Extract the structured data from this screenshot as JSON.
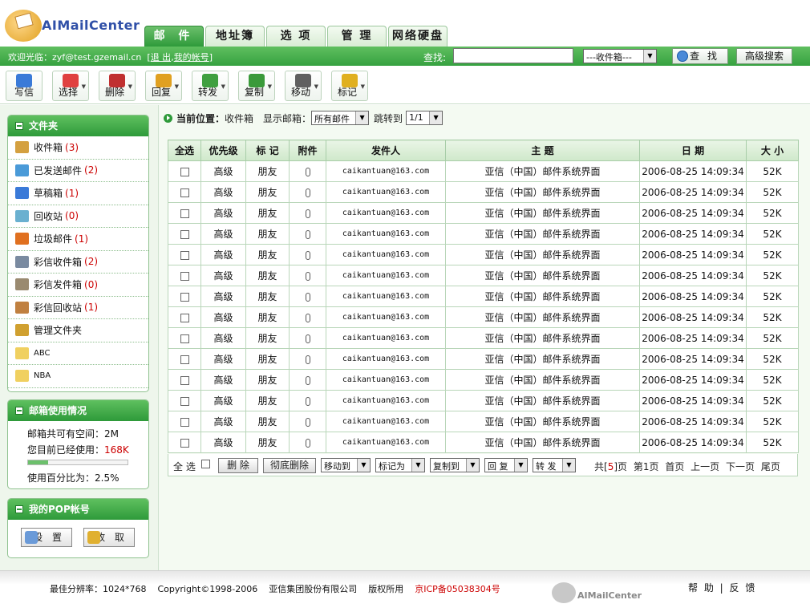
{
  "brand": {
    "logo_text": "AIMailCenter"
  },
  "tabs": [
    "邮 件",
    "地址簿",
    "选 项",
    "管 理",
    "网络硬盘"
  ],
  "topbar": {
    "welcome_prefix": "欢迎光临：zyf@test.gzemail.cn",
    "logout": "退 出",
    "my_account": "我的帐号",
    "search_label": "查找:",
    "search_value": "",
    "folder_select": "---收件箱---",
    "find_button": "查 找",
    "advanced_search": "高级搜索"
  },
  "toolbar": [
    {
      "label": "写信",
      "icon": "compose-icon",
      "color": "#3a7ad8",
      "dropdown": false
    },
    {
      "label": "选择",
      "icon": "checkmark-icon",
      "color": "#e04040",
      "dropdown": true
    },
    {
      "label": "删除",
      "icon": "delete-icon",
      "color": "#c03030",
      "dropdown": true
    },
    {
      "label": "回复",
      "icon": "reply-icon",
      "color": "#e0a020",
      "dropdown": true
    },
    {
      "label": "转发",
      "icon": "forward-icon",
      "color": "#40a040",
      "dropdown": true
    },
    {
      "label": "复制",
      "icon": "copy-icon",
      "color": "#3a9a3a",
      "dropdown": true
    },
    {
      "label": "移动",
      "icon": "move-icon",
      "color": "#606060",
      "dropdown": true
    },
    {
      "label": "标记",
      "icon": "flag-icon",
      "color": "#e0b020",
      "dropdown": true
    }
  ],
  "sidebar": {
    "folders_title": "文件夹",
    "folders": [
      {
        "name": "收件箱",
        "count": "(3)",
        "icon": "inbox-icon",
        "color": "#d4a040"
      },
      {
        "name": "已发送邮件",
        "count": "(2)",
        "icon": "sent-icon",
        "color": "#4a9ad8"
      },
      {
        "name": "草稿箱",
        "count": "(1)",
        "icon": "drafts-icon",
        "color": "#3a7ad8"
      },
      {
        "name": "回收站",
        "count": "(0)",
        "icon": "recycle-icon",
        "color": "#6ab0d0"
      },
      {
        "name": "垃圾邮件",
        "count": "(1)",
        "icon": "spam-icon",
        "color": "#e07020"
      },
      {
        "name": "彩信收件箱",
        "count": "(2)",
        "icon": "mms-inbox-icon",
        "color": "#7a8aa0"
      },
      {
        "name": "彩信发件箱",
        "count": "(0)",
        "icon": "mms-outbox-icon",
        "color": "#9a8a70"
      },
      {
        "name": "彩信回收站",
        "count": "(1)",
        "icon": "mms-recycle-icon",
        "color": "#c08040"
      },
      {
        "name": "管理文件夹",
        "count": "",
        "icon": "manage-folders-icon",
        "color": "#d0a030"
      },
      {
        "name": "ABC",
        "count": "",
        "icon": "folder-icon",
        "color": "#f0d060",
        "small": true
      },
      {
        "name": "NBA",
        "count": "",
        "icon": "folder-icon",
        "color": "#f0d060",
        "small": true
      }
    ],
    "usage_title": "邮箱使用情况",
    "usage_total": "邮箱共可有空间：2M",
    "usage_used_label": "您目前已经使用：",
    "usage_used_value": "168K",
    "usage_percent": "使用百分比为：2.5%",
    "usage_fraction": 0.2,
    "pop_title": "我的POP帐号",
    "pop_settings": "设 置",
    "pop_receive": "收 取"
  },
  "location": {
    "label": "当前位置：",
    "value": "收件箱",
    "show_label": "显示邮箱：",
    "show_value": "所有邮件",
    "jump_label": "跳转到",
    "page_value": "1/1"
  },
  "table": {
    "columns": [
      "全选",
      "优先级",
      "标 记",
      "附件",
      "发件人",
      "主 题",
      "日 期",
      "大 小"
    ],
    "rows": [
      {
        "priority": "高级",
        "tag": "朋友",
        "from": "caikantuan@163.com",
        "subject": "亚信（中国）邮件系统界面",
        "date": "2006-08-25 14:09:34",
        "size": "52K"
      },
      {
        "priority": "高级",
        "tag": "朋友",
        "from": "caikantuan@163.com",
        "subject": "亚信（中国）邮件系统界面",
        "date": "2006-08-25 14:09:34",
        "size": "52K"
      },
      {
        "priority": "高级",
        "tag": "朋友",
        "from": "caikantuan@163.com",
        "subject": "亚信（中国）邮件系统界面",
        "date": "2006-08-25 14:09:34",
        "size": "52K"
      },
      {
        "priority": "高级",
        "tag": "朋友",
        "from": "caikantuan@163.com",
        "subject": "亚信（中国）邮件系统界面",
        "date": "2006-08-25 14:09:34",
        "size": "52K"
      },
      {
        "priority": "高级",
        "tag": "朋友",
        "from": "caikantuan@163.com",
        "subject": "亚信（中国）邮件系统界面",
        "date": "2006-08-25 14:09:34",
        "size": "52K"
      },
      {
        "priority": "高级",
        "tag": "朋友",
        "from": "caikantuan@163.com",
        "subject": "亚信（中国）邮件系统界面",
        "date": "2006-08-25 14:09:34",
        "size": "52K"
      },
      {
        "priority": "高级",
        "tag": "朋友",
        "from": "caikantuan@163.com",
        "subject": "亚信（中国）邮件系统界面",
        "date": "2006-08-25 14:09:34",
        "size": "52K"
      },
      {
        "priority": "高级",
        "tag": "朋友",
        "from": "caikantuan@163.com",
        "subject": "亚信（中国）邮件系统界面",
        "date": "2006-08-25 14:09:34",
        "size": "52K"
      },
      {
        "priority": "高级",
        "tag": "朋友",
        "from": "caikantuan@163.com",
        "subject": "亚信（中国）邮件系统界面",
        "date": "2006-08-25 14:09:34",
        "size": "52K"
      },
      {
        "priority": "高级",
        "tag": "朋友",
        "from": "caikantuan@163.com",
        "subject": "亚信（中国）邮件系统界面",
        "date": "2006-08-25 14:09:34",
        "size": "52K"
      },
      {
        "priority": "高级",
        "tag": "朋友",
        "from": "caikantuan@163.com",
        "subject": "亚信（中国）邮件系统界面",
        "date": "2006-08-25 14:09:34",
        "size": "52K"
      },
      {
        "priority": "高级",
        "tag": "朋友",
        "from": "caikantuan@163.com",
        "subject": "亚信（中国）邮件系统界面",
        "date": "2006-08-25 14:09:34",
        "size": "52K"
      },
      {
        "priority": "高级",
        "tag": "朋友",
        "from": "caikantuan@163.com",
        "subject": "亚信（中国）邮件系统界面",
        "date": "2006-08-25 14:09:34",
        "size": "52K"
      },
      {
        "priority": "高级",
        "tag": "朋友",
        "from": "caikantuan@163.com",
        "subject": "亚信（中国）邮件系统界面",
        "date": "2006-08-25 14:09:34",
        "size": "52K"
      }
    ]
  },
  "actions": {
    "select_all": "全 选",
    "delete": "删 除",
    "purge": "彻底删除",
    "move_to": "移动到",
    "mark_as": "标记为",
    "copy_to": "复制到",
    "reply": "回 复",
    "forward": "转 发",
    "pager_prefix": "共[",
    "pager_pages": "5",
    "pager_suffix": "]页",
    "page_num": "第1页",
    "first": "首页",
    "prev": "上一页",
    "next": "下一页",
    "last": "尾页"
  },
  "footer": {
    "resolution": "最佳分辨率：1024*768",
    "copyright": "Copyright©1998-2006",
    "company": "亚信集团股份有限公司",
    "rights": "版权所用",
    "icp": "京ICP备05038304号",
    "logo_text": "AIMailCenter",
    "help": "帮 助",
    "sep": "|",
    "feedback": "反 馈"
  },
  "colors": {
    "accent": "#36a140",
    "header_green": "#5fbf5f",
    "count_red": "#cc0000"
  }
}
